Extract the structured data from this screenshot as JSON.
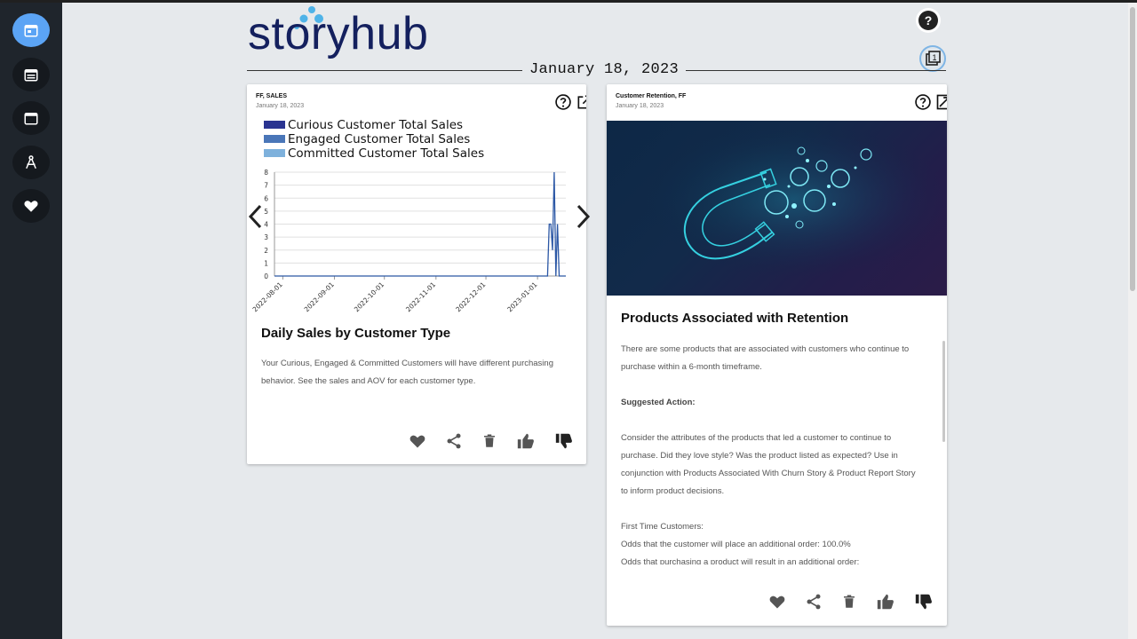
{
  "app": {
    "logo_text": "storyhub",
    "date_header": "January 18, 2023"
  },
  "sidebar": {
    "items": [
      {
        "name": "today-calendar",
        "active": true
      },
      {
        "name": "week-calendar",
        "active": false
      },
      {
        "name": "month-calendar",
        "active": false
      },
      {
        "name": "explore",
        "active": false
      },
      {
        "name": "favorites",
        "active": false
      }
    ]
  },
  "header": {
    "help_label": "?",
    "stack_count": "1"
  },
  "cards": [
    {
      "tags": "FF, SALES",
      "date": "January 18, 2023",
      "title": "Daily Sales by Customer Type",
      "body": "Your Curious, Engaged & Committed Customers will have different purchasing behavior. See the sales and AOV for each customer type."
    },
    {
      "tags": "Customer Retention, FF",
      "date": "January 18, 2023",
      "title": "Products Associated with Retention",
      "paragraphs": [
        "There are some products that are associated with customers who continue to purchase within a 6-month timeframe.",
        "Suggested Action:",
        "Consider the attributes of the products that led a customer to continue to purchase. Did they love style? Was the product listed as expected? Use in conjunction with Products Associated With Churn Story & Product Report Story to inform product decisions.",
        "First Time Customers:",
        "Odds that the customer will place an additional order: 100.0%",
        "Odds that purchasing a product will result in an additional order:"
      ]
    }
  ],
  "chart_data": {
    "type": "line",
    "title": "",
    "xlabel": "",
    "ylabel": "",
    "series_names": [
      "Curious Customer Total Sales",
      "Engaged Customer Total Sales",
      "Committed Customer Total Sales"
    ],
    "legend_colors": [
      "#2a3491",
      "#4a76b8",
      "#7eb1dc"
    ],
    "x_ticks": [
      "2022-08-01",
      "2022-09-01",
      "2022-10-01",
      "2022-11-01",
      "2022-12-01",
      "2023-01-01"
    ],
    "y_ticks": [
      "0",
      "1",
      "2",
      "3",
      "4",
      "5",
      "6",
      "7",
      "8"
    ],
    "ylim": [
      0,
      8
    ],
    "x_range": [
      "2022-07-27",
      "2023-01-18"
    ],
    "series": [
      {
        "color": "#2b57a5",
        "points": [
          [
            "2022-07-27",
            0
          ],
          [
            "2023-01-07",
            0
          ],
          [
            "2023-01-08",
            4
          ],
          [
            "2023-01-09",
            4
          ],
          [
            "2023-01-10",
            2
          ],
          [
            "2023-01-11",
            8
          ],
          [
            "2023-01-12",
            0
          ],
          [
            "2023-01-13",
            4
          ],
          [
            "2023-01-14",
            0
          ],
          [
            "2023-01-18",
            0
          ]
        ]
      }
    ],
    "legend_position": "top-left"
  },
  "colors": {
    "sidebar_bg": "#1f252c",
    "accent": "#5ba4f5",
    "logo": "#14205e",
    "logo_dots": "#4fb3e8"
  }
}
